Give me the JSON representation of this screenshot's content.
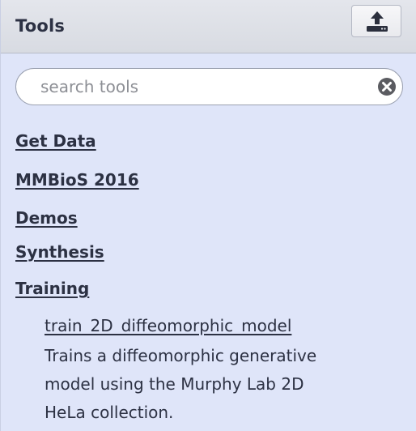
{
  "header": {
    "title": "Tools",
    "upload_icon": "upload-icon"
  },
  "search": {
    "placeholder": "search tools",
    "value": "",
    "clear_icon": "clear-icon"
  },
  "sections": [
    {
      "label": "Get Data"
    },
    {
      "label": "MMBioS 2016"
    },
    {
      "label": "Demos"
    },
    {
      "label": "Synthesis"
    },
    {
      "label": "Training"
    }
  ],
  "tool": {
    "name": "train_2D_diffeomorphic_model",
    "description_lines": [
      "Trains a diffeomorphic generative",
      "model using the Murphy Lab 2D",
      "HeLa collection."
    ]
  }
}
